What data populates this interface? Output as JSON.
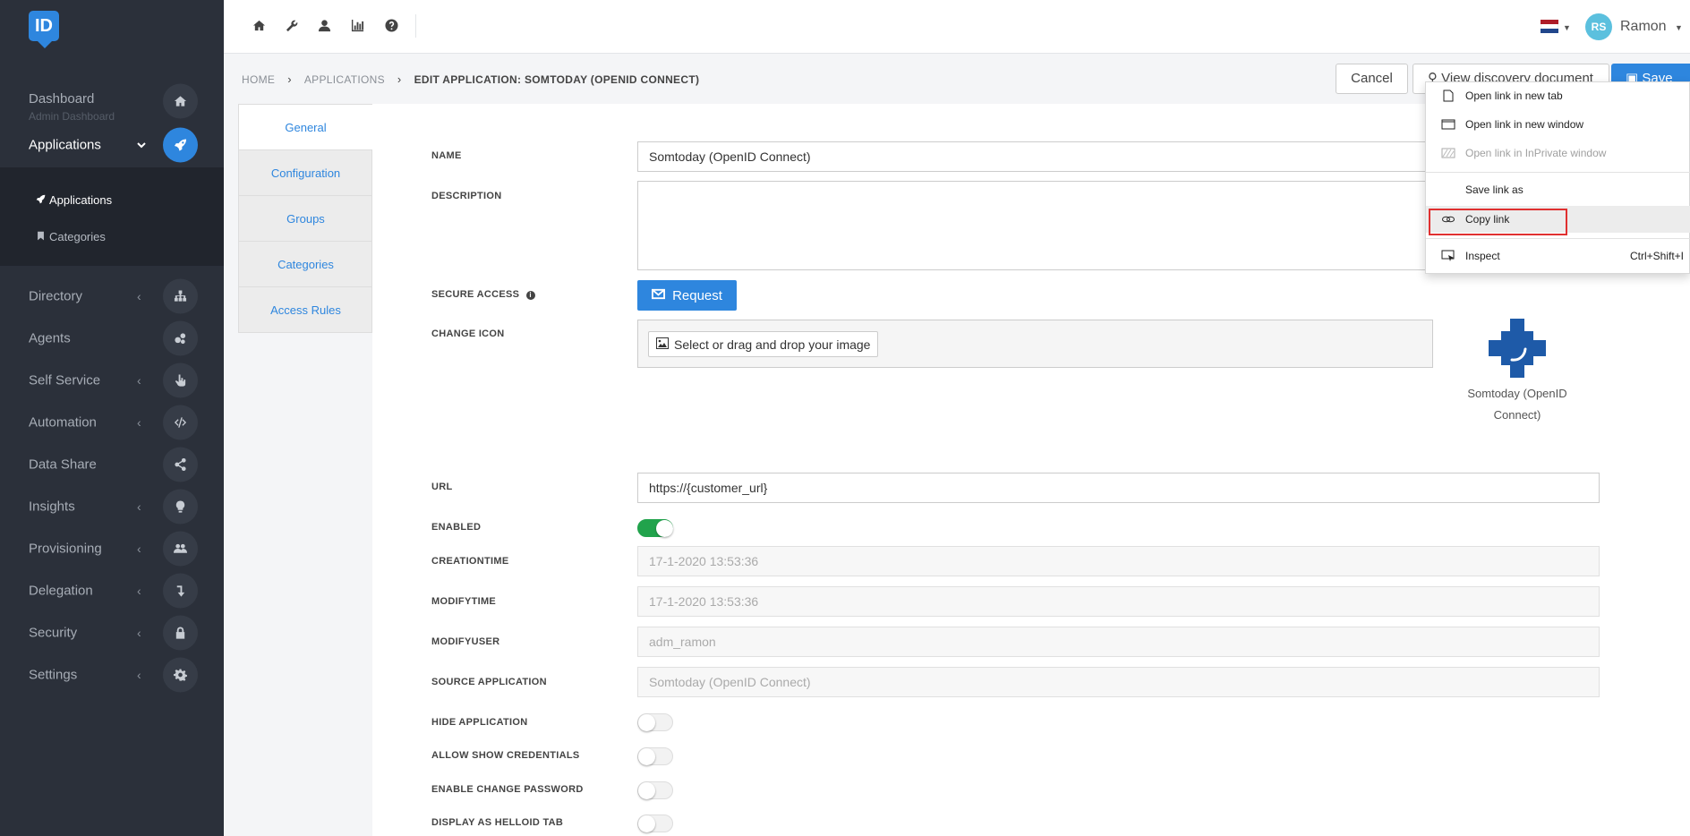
{
  "brand": {
    "logo_text": "ID",
    "accent": "#2e86de"
  },
  "sidebar": {
    "dashboard": {
      "label": "Dashboard",
      "sub": "Admin Dashboard",
      "icon": "home-icon"
    },
    "applications": {
      "label": "Applications",
      "icon": "rocket-icon"
    },
    "sub_items": [
      {
        "label": "Applications",
        "icon": "rocket-icon"
      },
      {
        "label": "Categories",
        "icon": "bookmark-icon"
      }
    ],
    "items": [
      {
        "label": "Directory",
        "icon": "sitemap-icon",
        "has_children": true
      },
      {
        "label": "Agents",
        "icon": "cogs-icon",
        "has_children": false
      },
      {
        "label": "Self Service",
        "icon": "pointer-icon",
        "has_children": true
      },
      {
        "label": "Automation",
        "icon": "code-icon",
        "has_children": true
      },
      {
        "label": "Data Share",
        "icon": "share-icon",
        "has_children": false
      },
      {
        "label": "Insights",
        "icon": "lightbulb-icon",
        "has_children": true
      },
      {
        "label": "Provisioning",
        "icon": "users-icon",
        "has_children": true
      },
      {
        "label": "Delegation",
        "icon": "level-down-icon",
        "has_children": true
      },
      {
        "label": "Security",
        "icon": "lock-icon",
        "has_children": true
      },
      {
        "label": "Settings",
        "icon": "gear-icon",
        "has_children": true
      }
    ]
  },
  "topbar": {
    "icons": [
      "home-icon",
      "wrench-icon",
      "user-icon",
      "bar-chart-icon",
      "question-icon"
    ],
    "user": {
      "initials": "RS",
      "name": "Ramon"
    }
  },
  "breadcrumb": {
    "home": "HOME",
    "applications": "APPLICATIONS",
    "current": "EDIT APPLICATION: SOMTODAY (OPENID CONNECT)"
  },
  "actions": {
    "cancel": "Cancel",
    "discovery": "View discovery document",
    "save": "Save"
  },
  "tabs": [
    "General",
    "Configuration",
    "Groups",
    "Categories",
    "Access Rules"
  ],
  "form": {
    "name_label": "NAME",
    "name_value": "Somtoday (OpenID Connect)",
    "description_label": "DESCRIPTION",
    "secure_access_label": "SECURE ACCESS",
    "request_label": "Request",
    "change_icon_label": "CHANGE ICON",
    "select_image_label": "Select or drag and drop your image",
    "app_caption": "Somtoday (OpenID Connect)",
    "url_label": "URL",
    "url_value": "https://{customer_url}",
    "enabled_label": "ENABLED",
    "enabled": true,
    "creationtime_label": "CREATIONTIME",
    "creationtime_value": "17-1-2020 13:53:36",
    "modifytime_label": "MODIFYTIME",
    "modifytime_value": "17-1-2020 13:53:36",
    "modifyuser_label": "MODIFYUSER",
    "modifyuser_value": "adm_ramon",
    "source_label": "SOURCE APPLICATION",
    "source_value": "Somtoday (OpenID Connect)",
    "hide_label": "HIDE APPLICATION",
    "hide": false,
    "allow_show_label": "ALLOW SHOW CREDENTIALS",
    "allow_show": false,
    "change_pw_label": "ENABLE CHANGE PASSWORD",
    "change_pw": false,
    "display_tab_label": "DISPLAY AS HELLOID TAB",
    "display_tab": false
  },
  "context_menu": {
    "items": [
      {
        "label": "Open link in new tab",
        "icon": "new-tab-icon",
        "disabled": false
      },
      {
        "label": "Open link in new window",
        "icon": "new-window-icon",
        "disabled": false
      },
      {
        "label": "Open link in InPrivate window",
        "icon": "inprivate-icon",
        "disabled": true
      },
      {
        "label": "Save link as",
        "icon": "",
        "disabled": false
      },
      {
        "label": "Copy link",
        "icon": "link-icon",
        "disabled": false
      },
      {
        "label": "Inspect",
        "icon": "inspect-icon",
        "disabled": false,
        "shortcut": "Ctrl+Shift+I"
      }
    ]
  }
}
